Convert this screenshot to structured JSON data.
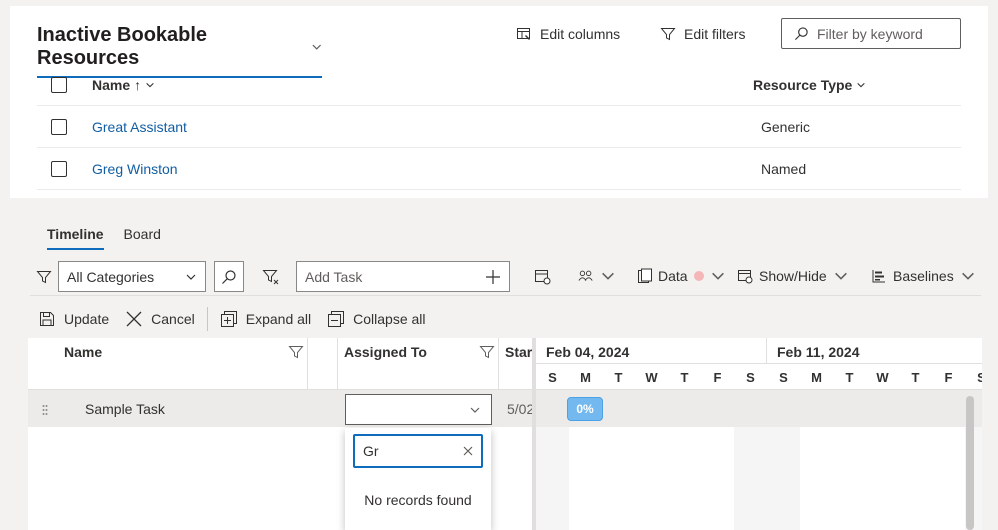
{
  "grid": {
    "view_title": "Inactive Bookable Resources",
    "edit_columns": "Edit columns",
    "edit_filters": "Edit filters",
    "keyword_placeholder": "Filter by keyword",
    "columns": {
      "name": "Name",
      "name_sort": "↑",
      "resource_type": "Resource Type"
    },
    "rows": [
      {
        "name": "Great Assistant",
        "type": "Generic"
      },
      {
        "name": "Greg Winston",
        "type": "Named"
      }
    ]
  },
  "tabs": [
    {
      "label": "Timeline",
      "active": true
    },
    {
      "label": "Board",
      "active": false
    }
  ],
  "toolbar": {
    "category": "All Categories",
    "add_task_placeholder": "Add Task",
    "data_label": "Data",
    "show_hide_label": "Show/Hide",
    "baselines_label": "Baselines"
  },
  "actions": {
    "update": "Update",
    "cancel": "Cancel",
    "expand_all": "Expand all",
    "collapse_all": "Collapse all"
  },
  "gantt": {
    "columns": {
      "name": "Name",
      "assigned_to": "Assigned To",
      "start": "Start"
    },
    "row": {
      "task": "Sample Task",
      "start": "5/02",
      "progress": "0%"
    },
    "weeks": [
      "Feb 04, 2024",
      "Feb 11, 2024"
    ],
    "days": [
      "S",
      "M",
      "T",
      "W",
      "T",
      "F",
      "S",
      "S",
      "M",
      "T",
      "W",
      "T",
      "F",
      "S"
    ]
  },
  "assign_popup": {
    "search_value": "Gr",
    "empty_text": "No records found"
  },
  "colors": {
    "accent": "#0f6cbd",
    "link": "#115ea3",
    "progress_bar": "#73b9f0"
  }
}
